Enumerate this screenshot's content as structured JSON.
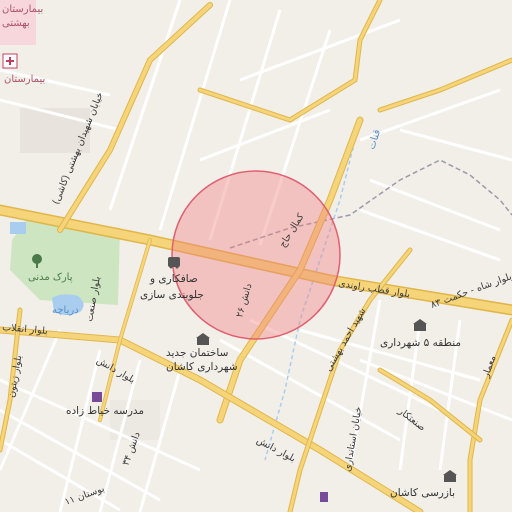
{
  "map": {
    "circle_color": "#f08080",
    "colors": {
      "background": "#f2efe9",
      "road_major": "#f6d57a",
      "road_major_casing": "#e0b64a",
      "road_minor": "#ffffff",
      "park": "#cde5c0",
      "water": "#a9cdef",
      "hospital": "#f8d7dc",
      "highlight_area": "#f08080"
    },
    "labels": {
      "hospital_top": "بیمارستان",
      "hospital_top2": "بهشتی",
      "hospital_left": "بیمارستان",
      "street_shahidan": "خیابان شهیدان بهشتی (کاشی)",
      "qanat": "قنات",
      "kamal_haji": "کمال حاج",
      "qotb_ravandi": "بلوار قطب راوندی",
      "hekmat_shah": "بلوار شاه - حکمت ۸۳",
      "park_madani": "پارک مدنی",
      "daryacheh": "دریاچه",
      "sazi_1": "صافکاری و",
      "sazi_2": "جلوبندی سازی",
      "danesh_26": "دانش ۲۶",
      "building_1": "ساختمان جدید",
      "building_2": "شهرداری کاشان",
      "shahid_ahmad": "شهید احمد بهشتی",
      "region5": "منطقه ۵ شهرداری",
      "blvd_danesh_left": "بلوار دانش",
      "blvd_danesh_bottom": "بلوار دانش",
      "school": "مدرسه خیاط زاده",
      "danesh_34": "دانش ۳۴",
      "bostan_11": "بوستان ۱۱",
      "ostandari": "خیابان استانداری",
      "bazrasi": "بازرسی کاشان",
      "sanat_kar": "صنعتکار",
      "moemar": "معمار",
      "sanat_left": "بلوار صنعت",
      "blvd_zeytun": "بلوار زیتون",
      "blvd_enghelab": "بلوار انقلاب"
    }
  }
}
